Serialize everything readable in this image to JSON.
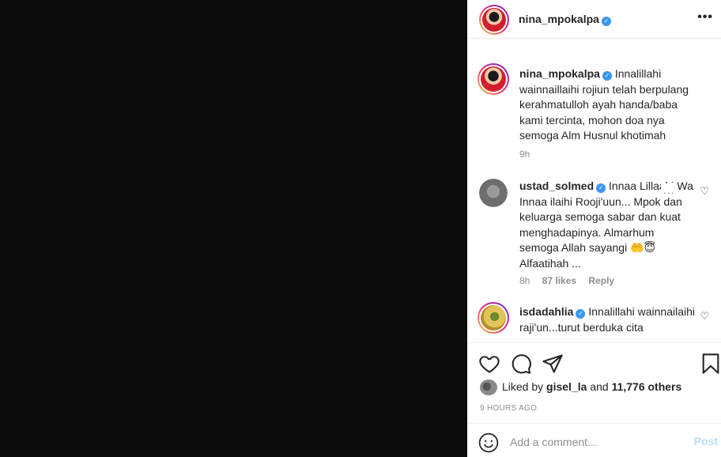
{
  "post": {
    "author": "nina_mpokalpa",
    "more_icon": "more-horizontal-icon"
  },
  "caption": {
    "username": "nina_mpokalpa",
    "text": "Innalillahi wainnaillaihi rojiun telah berpulang kerahmatulloh ayah handa/baba kami tercinta, mohon doa nya semoga Alm Husnul khotimah",
    "time": "9h"
  },
  "comments": [
    {
      "username": "ustad_solmed",
      "text": "Innaa Lillaahi Wa Innaa ilaihi Rooji'uun... Mpok dan keluarga semoga sabar dan kuat menghadapinya. Almarhum semoga Allah sayangi 🤲😇 Alfaatihah ...",
      "time": "8h",
      "likes": "87 likes",
      "reply": "Reply",
      "more": "..."
    },
    {
      "username": "isdadahlia",
      "text": "Innalillahi wainnailaihi raji'un...turut berduka cita",
      "time": "",
      "likes": "",
      "reply": ""
    }
  ],
  "liked_by": {
    "prefix": "Liked by",
    "user": "gisel_la",
    "joiner": "and",
    "others": "11,776 others"
  },
  "timestamp": "9 HOURS AGO",
  "composer": {
    "placeholder": "Add a comment...",
    "post_label": "Post"
  }
}
